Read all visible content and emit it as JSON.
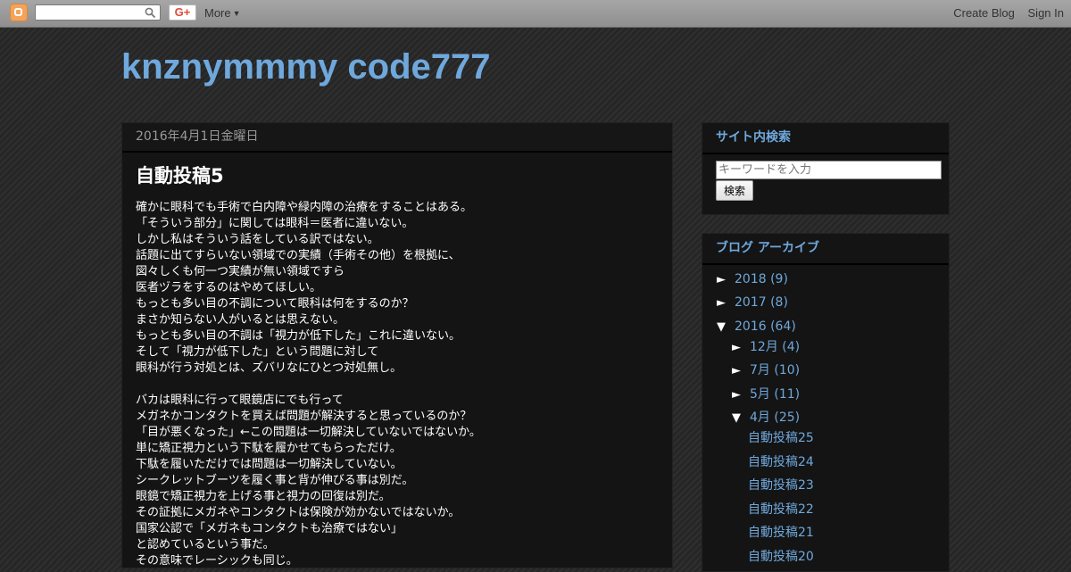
{
  "navbar": {
    "more_label": "More",
    "gplus_label": "G+",
    "create_blog": "Create Blog",
    "sign_in": "Sign In"
  },
  "header": {
    "title": "knznymmmy code777"
  },
  "post": {
    "date": "2016年4月1日金曜日",
    "title": "自動投稿5",
    "lines": [
      "確かに眼科でも手術で白内障や緑内障の治療をすることはある。",
      "「そういう部分」に関しては眼科＝医者に違いない。",
      "しかし私はそういう話をしている訳ではない。",
      "話題に出てすらいない領域での実績（手術その他）を根拠に、",
      "図々しくも何一つ実績が無い領域ですら",
      "医者ヅラをするのはやめてほしい。",
      "もっとも多い目の不調について眼科は何をするのか？",
      "まさか知らない人がいるとは思えない。",
      "もっとも多い目の不調は「視力が低下した」これに違いない。",
      "そして「視力が低下した」という問題に対して",
      "眼科が行う対処とは、ズバリなにひとつ対処無し。",
      "",
      "バカは眼科に行って眼鏡店にでも行って",
      "メガネかコンタクトを買えば問題が解決すると思っているのか？",
      "「目が悪くなった」←この問題は一切解決していないではないか。",
      "単に矯正視力という下駄を履かせてもらっただけ。",
      "下駄を履いただけでは問題は一切解決していない。",
      "シークレットブーツを履く事と背が伸びる事は別だ。",
      "眼鏡で矯正視力を上げる事と視力の回復は別だ。",
      "その証拠にメガネやコンタクトは保険が効かないではないか。",
      "国家公認で「メガネもコンタクトも治療ではない」",
      "と認めているという事だ。",
      "その意味でレーシックも同じ。"
    ]
  },
  "sidebar": {
    "search": {
      "title": "サイト内検索",
      "placeholder": "キーワードを入力",
      "button": "検索"
    },
    "archive": {
      "title": "ブログ アーカイブ",
      "years": [
        {
          "toggle": "►",
          "label": "2018 (9)"
        },
        {
          "toggle": "►",
          "label": "2017 (8)"
        },
        {
          "toggle": "▼",
          "label": "2016 (64)"
        }
      ],
      "months": [
        {
          "toggle": "►",
          "label": "12月 (4)"
        },
        {
          "toggle": "►",
          "label": "7月 (10)"
        },
        {
          "toggle": "►",
          "label": "5月 (11)"
        },
        {
          "toggle": "▼",
          "label": "4月 (25)"
        }
      ],
      "posts": [
        "自動投稿25",
        "自動投稿24",
        "自動投稿23",
        "自動投稿22",
        "自動投稿21",
        "自動投稿20"
      ]
    }
  }
}
